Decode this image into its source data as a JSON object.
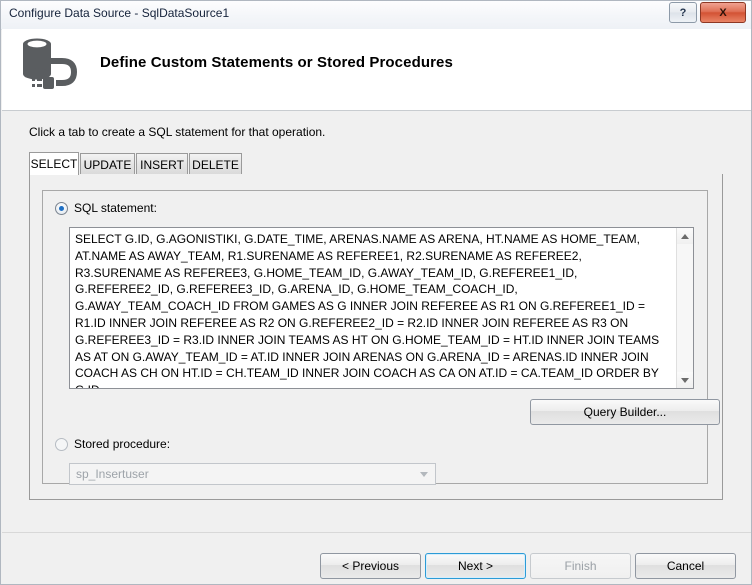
{
  "window": {
    "title": "Configure Data Source - SqlDataSource1",
    "help_label": "?",
    "close_label": "X"
  },
  "header": {
    "title": "Define Custom Statements or Stored Procedures",
    "icon": "database-plug-icon"
  },
  "body": {
    "instruction": "Click a tab to create a SQL statement for that operation."
  },
  "tabs": [
    {
      "label": "SELECT",
      "active": true
    },
    {
      "label": "UPDATE",
      "active": false
    },
    {
      "label": "INSERT",
      "active": false
    },
    {
      "label": "DELETE",
      "active": false
    }
  ],
  "sql_option": {
    "label": "SQL statement:",
    "selected": true,
    "text": "SELECT G.ID, G.AGONISTIKI, G.DATE_TIME, ARENAS.NAME AS ARENA, HT.NAME AS HOME_TEAM, AT.NAME AS AWAY_TEAM, R1.SURENAME AS REFEREE1, R2.SURENAME AS REFEREE2, R3.SURENAME AS REFEREE3, G.HOME_TEAM_ID, G.AWAY_TEAM_ID, G.REFEREE1_ID, G.REFEREE2_ID, G.REFEREE3_ID, G.ARENA_ID, G.HOME_TEAM_COACH_ID, G.AWAY_TEAM_COACH_ID FROM GAMES AS G INNER JOIN REFEREE AS R1 ON G.REFEREE1_ID = R1.ID INNER JOIN REFEREE AS R2 ON G.REFEREE2_ID = R2.ID INNER JOIN REFEREE AS R3 ON G.REFEREE3_ID = R3.ID INNER JOIN TEAMS AS HT ON G.HOME_TEAM_ID = HT.ID INNER JOIN TEAMS AS AT ON G.AWAY_TEAM_ID = AT.ID INNER JOIN ARENAS ON G.ARENA_ID = ARENAS.ID INNER JOIN COACH AS CH ON HT.ID = CH.TEAM_ID INNER JOIN COACH AS CA ON AT.ID = CA.TEAM_ID ORDER BY G.ID"
  },
  "query_builder": {
    "label": "Query Builder..."
  },
  "stored_procedure": {
    "label": "Stored procedure:",
    "selected": false,
    "value": "sp_Insertuser"
  },
  "footer": {
    "previous": "< Previous",
    "next": "Next >",
    "finish": "Finish",
    "cancel": "Cancel"
  }
}
